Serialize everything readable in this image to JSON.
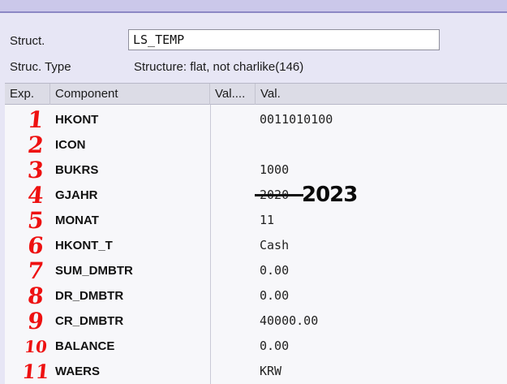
{
  "header_fields": {
    "struct_label": "Struct.",
    "struct_value": "LS_TEMP",
    "type_label": "Struc. Type",
    "type_value": "Structure: flat, not charlike(146)"
  },
  "columns": {
    "exp": "Exp.",
    "component": "Component",
    "val_short": "Val....",
    "val": "Val."
  },
  "rows": [
    {
      "num": "1",
      "component": "HKONT",
      "value": "0011010100"
    },
    {
      "num": "2",
      "component": "ICON",
      "value": ""
    },
    {
      "num": "3",
      "component": "BUKRS",
      "value": "1000"
    },
    {
      "num": "4",
      "component": "GJAHR",
      "value": "2020",
      "handwritten": "2023"
    },
    {
      "num": "5",
      "component": "MONAT",
      "value": "11"
    },
    {
      "num": "6",
      "component": "HKONT_T",
      "value": "Cash"
    },
    {
      "num": "7",
      "component": "SUM_DMBTR",
      "value": "0.00"
    },
    {
      "num": "8",
      "component": "DR_DMBTR",
      "value": "0.00"
    },
    {
      "num": "9",
      "component": "CR_DMBTR",
      "value": "40000.00"
    },
    {
      "num": "10",
      "component": "BALANCE",
      "value": "0.00"
    },
    {
      "num": "11",
      "component": "WAERS",
      "value": "KRW"
    }
  ],
  "colors": {
    "background": "#e7e6f5",
    "annotation": "#ee1111"
  }
}
